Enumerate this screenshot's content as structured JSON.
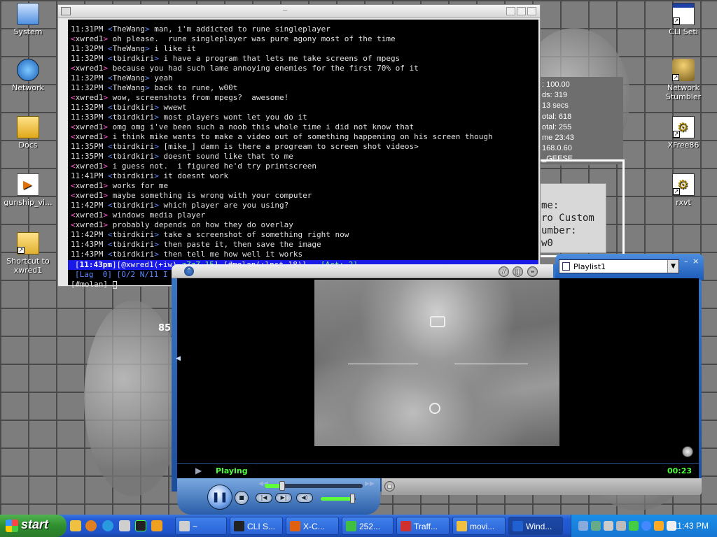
{
  "desktop": {
    "icons_left": [
      {
        "name": "System",
        "kind": "system"
      },
      {
        "name": "Network",
        "kind": "network"
      },
      {
        "name": "Docs",
        "kind": "docs"
      },
      {
        "name": "gunship_vi...",
        "kind": "media"
      },
      {
        "name": "Shortcut to xwred1",
        "kind": "folder"
      }
    ],
    "icons_right": [
      {
        "name": "CLI Seti",
        "kind": "window"
      },
      {
        "name": "Network Stumbler",
        "kind": "antenna"
      },
      {
        "name": "XFree86",
        "kind": "gear"
      },
      {
        "name": "rxvt",
        "kind": "gear"
      }
    ],
    "bg_info_lines": [
      ": 100.00",
      "ds:  319",
      "13 secs",
      "otal: 618",
      "otal: 255",
      "me 23:43",
      "168.0.60",
      "_GEESE"
    ],
    "bg_form_lines": [
      "me:",
      "ro Custom",
      "umber:",
      "w0"
    ],
    "bg_number": "85"
  },
  "terminal": {
    "title": "~",
    "lines": [
      {
        "time": "11:31PM",
        "nick": "TheWang",
        "mode": "t",
        "msg": "man, i'm addicted to rune singleplayer"
      },
      {
        "time": "",
        "nick": "xwred1",
        "mode": "o",
        "msg": "oh please.  rune singleplayer was pure agony most of the time"
      },
      {
        "time": "11:32PM",
        "nick": "TheWang",
        "mode": "t",
        "msg": "i like it"
      },
      {
        "time": "11:32PM",
        "nick": "tbirdkiri",
        "mode": "t",
        "msg": "i have a program that lets me take screens of mpegs"
      },
      {
        "time": "",
        "nick": "xwred1",
        "mode": "o",
        "msg": "because you had such lame annoying enemies for the first 70% of it"
      },
      {
        "time": "11:32PM",
        "nick": "TheWang",
        "mode": "t",
        "msg": "yeah"
      },
      {
        "time": "11:32PM",
        "nick": "TheWang",
        "mode": "t",
        "msg": "back to rune, w00t"
      },
      {
        "time": "",
        "nick": "xwred1",
        "mode": "o",
        "msg": "wow, screenshots from mpegs?  awesome!"
      },
      {
        "time": "11:32PM",
        "nick": "tbirdkiri",
        "mode": "t",
        "msg": "wwewt"
      },
      {
        "time": "11:33PM",
        "nick": "tbirdkiri",
        "mode": "t",
        "msg": "most players wont let you do it"
      },
      {
        "time": "",
        "nick": "xwred1",
        "mode": "o",
        "msg": "omg omg i've been such a noob this whole time i did not know that"
      },
      {
        "time": "",
        "nick": "xwred1",
        "mode": "o",
        "msg": "i think mike wants to make a video out of something happening on his screen though"
      },
      {
        "time": "11:35PM",
        "nick": "tbirdkiri",
        "mode": "t",
        "msg": "[mike_] damn is there a progream to screen shot videos>"
      },
      {
        "time": "11:35PM",
        "nick": "tbirdkiri",
        "mode": "t",
        "msg": "doesnt sound like that to me"
      },
      {
        "time": "",
        "nick": "xwred1",
        "mode": "o",
        "msg": "i guess not.  i figured he'd try printscreen"
      },
      {
        "time": "11:41PM",
        "nick": "tbirdkiri",
        "mode": "t",
        "msg": "it doesnt work"
      },
      {
        "time": "",
        "nick": "xwred1",
        "mode": "o",
        "msg": "works for me"
      },
      {
        "time": "",
        "nick": "xwred1",
        "mode": "o",
        "msg": "maybe something is wrong with your computer"
      },
      {
        "time": "11:42PM",
        "nick": "tbirdkiri",
        "mode": "t",
        "msg": "which player are you using?"
      },
      {
        "time": "",
        "nick": "xwred1",
        "mode": "o",
        "msg": "windows media player"
      },
      {
        "time": "",
        "nick": "xwred1",
        "mode": "o",
        "msg": "probably depends on how they do overlay"
      },
      {
        "time": "11:42PM",
        "nick": "tbirdkiri",
        "mode": "t",
        "msg": "take a screenshot of something right now"
      },
      {
        "time": "11:43PM",
        "nick": "tbirdkiri",
        "mode": "t",
        "msg": "then paste it, then save the image"
      },
      {
        "time": "11:43PM",
        "nick": "tbirdkiri",
        "mode": "t",
        "msg": "then tell me how well it works"
      }
    ],
    "status1": {
      "clock": "11:43pm",
      "user": "@xwred1(+iw)",
      "away": "zZzZ 15",
      "channel": "[#molan(+lnst 18)]",
      "act": "[Act: 2]"
    },
    "status2": "[Lag  0] [O/2 N/11 I",
    "prompt": "[#molan] "
  },
  "media_player": {
    "playlist": "Playlist1",
    "state": "Playing",
    "time": "00:23",
    "seek_fraction": 0.18,
    "volume_fraction": 0.9
  },
  "taskbar": {
    "start_label": "start",
    "tasks": [
      {
        "label": "~",
        "icon_color": "#cfcfcf",
        "active": false
      },
      {
        "label": "CLI S...",
        "icon_color": "#222222",
        "active": false
      },
      {
        "label": "X-C...",
        "icon_color": "#e06010",
        "active": false
      },
      {
        "label": "252...",
        "icon_color": "#40c040",
        "active": false
      },
      {
        "label": "Traff...",
        "icon_color": "#d03030",
        "active": false
      },
      {
        "label": "movi...",
        "icon_color": "#f0c040",
        "active": false
      },
      {
        "label": "Wind...",
        "icon_color": "#2060d0",
        "active": true
      }
    ],
    "clock": "11:43 PM"
  }
}
